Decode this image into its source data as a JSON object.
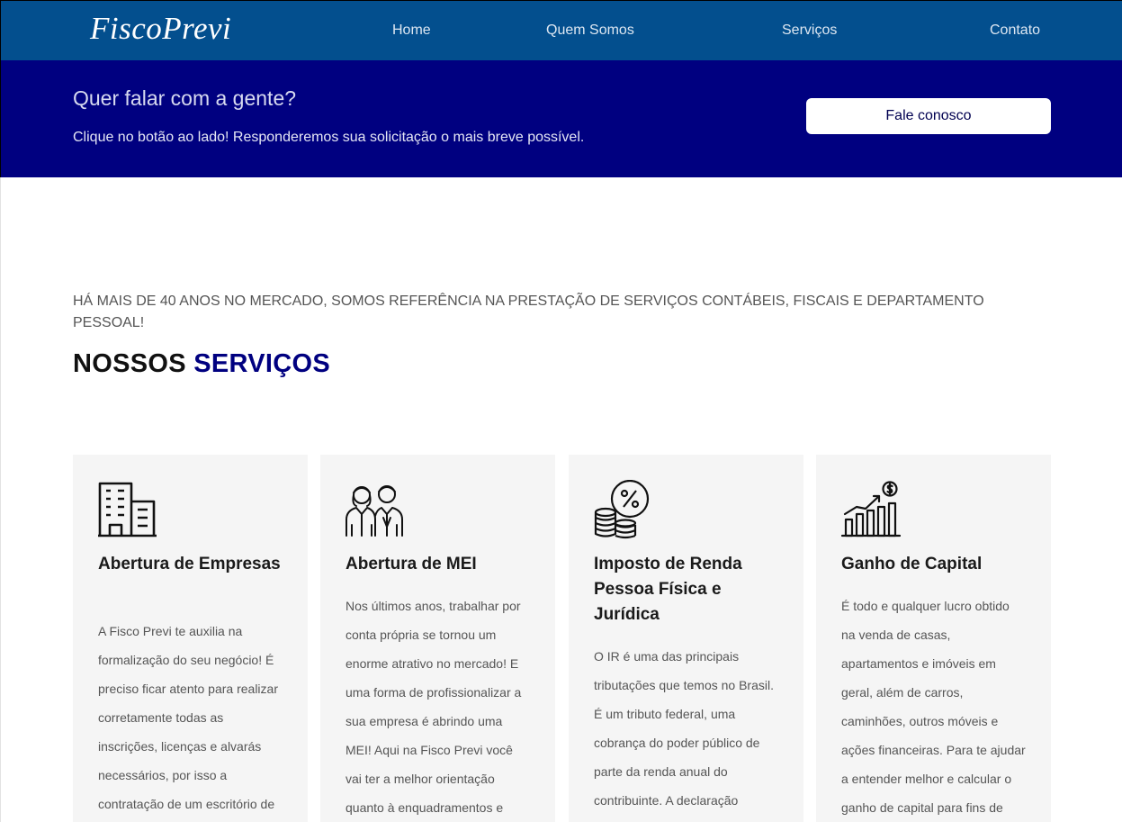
{
  "navbar": {
    "logo": "FiscoPrevi",
    "links": [
      "Home",
      "Quem Somos",
      "Serviços",
      "Contato"
    ]
  },
  "cta": {
    "title": "Quer falar com a gente?",
    "text": "Clique no botão ao lado! Responderemos sua solicitação o mais breve possível.",
    "button": "Fale conosco"
  },
  "intro": {
    "lead": "Há mais de 40 anos no mercado, somos referência na prestação de serviços contábeis, fiscais e departamento pessoal!",
    "title_part1": "NOSSOS",
    "title_part2": "SERVIÇOS"
  },
  "services": [
    {
      "icon": "building-icon",
      "title": "Abertura de Empresas",
      "lines": [
        "A Fisco Previ te auxilia na",
        "formalização do seu negócio! É",
        "preciso ficar atento para realizar",
        "corretamente todas as",
        "inscrições, licenças e alvarás",
        "necessários, por isso a",
        "contratação de um escritório de"
      ]
    },
    {
      "icon": "people-icon",
      "title": "Abertura de MEI",
      "lines": [
        "Nos últimos anos, trabalhar por",
        "conta própria se tornou um",
        "enorme atrativo no mercado! E",
        "uma forma de profissionalizar a",
        "sua empresa é abrindo uma",
        "MEI! Aqui na Fisco Previ você",
        "vai ter a melhor orientação",
        "quanto à enquadramentos e"
      ]
    },
    {
      "icon": "percent-coins-icon",
      "title": "Imposto de Renda Pessoa Física e Jurídica",
      "lines": [
        "O IR é uma das principais",
        "tributações que temos no Brasil.",
        "É um tributo federal, uma",
        "cobrança do poder público de",
        "parte da renda anual do",
        "contribuinte. A declaração"
      ]
    },
    {
      "icon": "growth-chart-icon",
      "title": "Ganho de Capital",
      "lines": [
        "É todo e qualquer lucro obtido",
        "na venda de casas,",
        "apartamentos e imóveis em",
        "geral, além de carros,",
        "caminhões, outros móveis e",
        "ações financeiras. Para te ajudar",
        "a entender melhor e calcular o",
        "ganho de capital para fins de"
      ]
    }
  ]
}
